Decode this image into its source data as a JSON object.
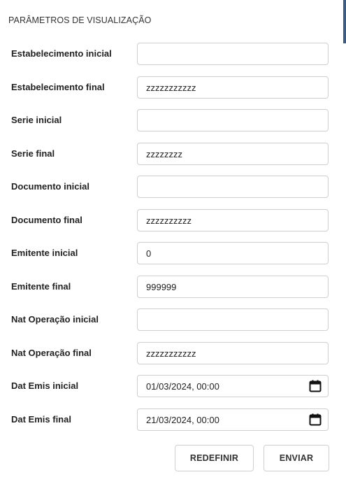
{
  "panel": {
    "title": "PARÂMETROS DE VISUALIZAÇÃO"
  },
  "fields": [
    {
      "label": "Estabelecimento inicial",
      "value": "",
      "type": "text"
    },
    {
      "label": "Estabelecimento final",
      "value": "zzzzzzzzzzz",
      "type": "text"
    },
    {
      "label": "Serie inicial",
      "value": "",
      "type": "text"
    },
    {
      "label": "Serie final",
      "value": "zzzzzzzz",
      "type": "text"
    },
    {
      "label": "Documento inicial",
      "value": "",
      "type": "text"
    },
    {
      "label": "Documento final",
      "value": "zzzzzzzzzz",
      "type": "text"
    },
    {
      "label": "Emitente inicial",
      "value": "0",
      "type": "text"
    },
    {
      "label": "Emitente final",
      "value": "999999",
      "type": "text"
    },
    {
      "label": "Nat Operação inicial",
      "value": "",
      "type": "text"
    },
    {
      "label": "Nat Operação final",
      "value": "zzzzzzzzzzz",
      "type": "text"
    },
    {
      "label": "Dat Emis inicial",
      "value": "01/03/2024, 00:00",
      "type": "datetime",
      "icon": "calendar-icon"
    },
    {
      "label": "Dat Emis final",
      "value": "21/03/2024, 00:00",
      "type": "datetime",
      "icon": "calendar-icon"
    }
  ],
  "actions": {
    "reset_label": "REDEFINIR",
    "submit_label": "ENVIAR"
  },
  "colors": {
    "scroll_indicator": "#3d5a80",
    "input_border": "#cfcfcf"
  }
}
